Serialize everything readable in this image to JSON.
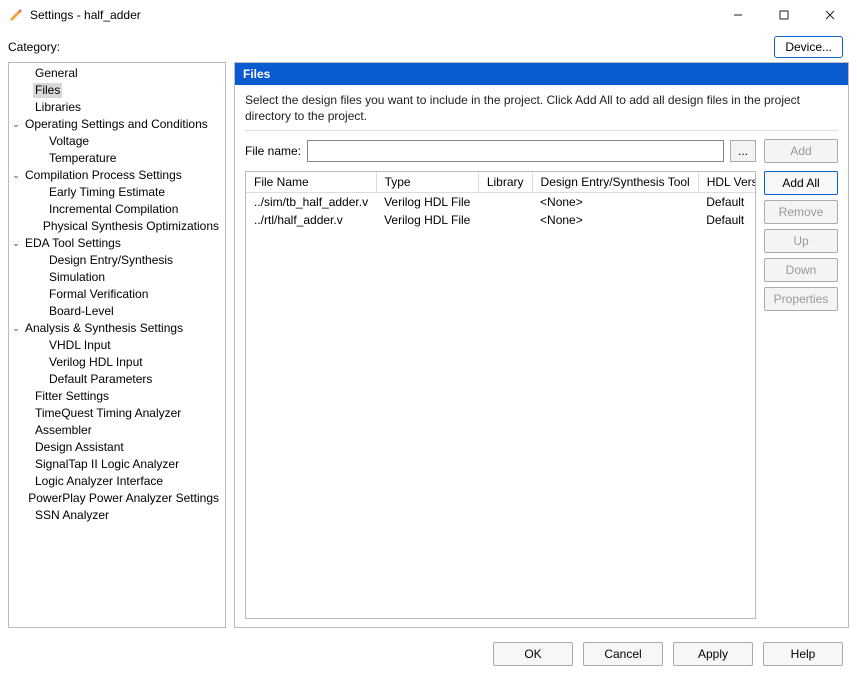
{
  "window": {
    "title": "Settings - half_adder"
  },
  "toprow": {
    "category_label": "Category:",
    "device_btn": "Device..."
  },
  "tree": [
    {
      "label": "General",
      "level": 1
    },
    {
      "label": "Files",
      "level": 1,
      "selected": true
    },
    {
      "label": "Libraries",
      "level": 1
    },
    {
      "label": "Operating Settings and Conditions",
      "level": 0,
      "expand": true
    },
    {
      "label": "Voltage",
      "level": 2
    },
    {
      "label": "Temperature",
      "level": 2
    },
    {
      "label": "Compilation Process Settings",
      "level": 0,
      "expand": true
    },
    {
      "label": "Early Timing Estimate",
      "level": 2
    },
    {
      "label": "Incremental Compilation",
      "level": 2
    },
    {
      "label": "Physical Synthesis Optimizations",
      "level": 2
    },
    {
      "label": "EDA Tool Settings",
      "level": 0,
      "expand": true
    },
    {
      "label": "Design Entry/Synthesis",
      "level": 2
    },
    {
      "label": "Simulation",
      "level": 2
    },
    {
      "label": "Formal Verification",
      "level": 2
    },
    {
      "label": "Board-Level",
      "level": 2
    },
    {
      "label": "Analysis & Synthesis Settings",
      "level": 0,
      "expand": true
    },
    {
      "label": "VHDL Input",
      "level": 2
    },
    {
      "label": "Verilog HDL Input",
      "level": 2
    },
    {
      "label": "Default Parameters",
      "level": 2
    },
    {
      "label": "Fitter Settings",
      "level": 1
    },
    {
      "label": "TimeQuest Timing Analyzer",
      "level": 1
    },
    {
      "label": "Assembler",
      "level": 1
    },
    {
      "label": "Design Assistant",
      "level": 1
    },
    {
      "label": "SignalTap II Logic Analyzer",
      "level": 1
    },
    {
      "label": "Logic Analyzer Interface",
      "level": 1
    },
    {
      "label": "PowerPlay Power Analyzer Settings",
      "level": 1
    },
    {
      "label": "SSN Analyzer",
      "level": 1
    }
  ],
  "panel": {
    "header": "Files",
    "description": "Select the design files you want to include in the project. Click Add All to add all design files in the project directory to the project.",
    "filename_label": "File name:",
    "filename_value": "",
    "browse": "..."
  },
  "table": {
    "headers": [
      "File Name",
      "Type",
      "Library",
      "Design Entry/Synthesis Tool",
      "HDL Version"
    ],
    "rows": [
      {
        "file": "../sim/tb_half_adder.v",
        "type": "Verilog HDL File",
        "library": "",
        "tool": "<None>",
        "hdl": "Default"
      },
      {
        "file": "../rtl/half_adder.v",
        "type": "Verilog HDL File",
        "library": "",
        "tool": "<None>",
        "hdl": "Default"
      }
    ]
  },
  "sidebtns": {
    "add": "Add",
    "add_all": "Add All",
    "remove": "Remove",
    "up": "Up",
    "down": "Down",
    "properties": "Properties"
  },
  "bottom": {
    "ok": "OK",
    "cancel": "Cancel",
    "apply": "Apply",
    "help": "Help"
  }
}
